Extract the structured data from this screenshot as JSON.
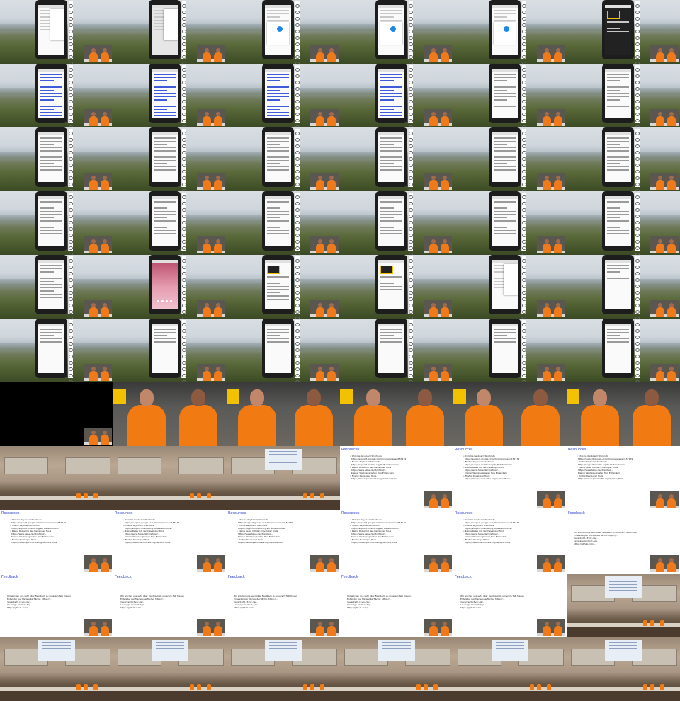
{
  "sheet": {
    "columns": 6,
    "rows": 11
  },
  "slides": {
    "resources_title": "Resources",
    "resources_items": [
      "• Chrome Keyboard Shortcuts",
      "  https://support.google.com/chrome/answer/157179",
      "• Firefox Keyboard Shortcuts",
      "  https://support.mozilla.org/kb/Tastaturkürzel",
      "• Kleine Reise mit den Developer Tools",
      "  https://www.heise.de/ct/artikel/...",
      "  Kleiner Werkzeugkasten fürs Entwickeln",
      "• Firefox Developer Tools",
      "  https://developer.mozilla.org/de/docs/Tools"
    ],
    "feedback_title": "Feedback",
    "feedback_lines": [
      "Wir würden uns sehr über Feedback zu unserem Talk freuen",
      "Entweder per Mensaoberfläche: https://...",
      "//events23.c3voc.de/...",
      "Leverage Android App",
      "https://github.com/..."
    ]
  },
  "cells": [
    {
      "kind": "phone",
      "screen": "menu",
      "pip": true
    },
    {
      "kind": "phone",
      "screen": "menu-gray",
      "pip": true
    },
    {
      "kind": "phone",
      "screen": "dialog",
      "pip": true
    },
    {
      "kind": "phone",
      "screen": "dialog",
      "pip": true
    },
    {
      "kind": "phone",
      "screen": "dialog",
      "pip": true
    },
    {
      "kind": "phone",
      "screen": "logo-dark",
      "pip": true
    },
    {
      "kind": "phone",
      "screen": "links",
      "pip": true
    },
    {
      "kind": "phone",
      "screen": "links",
      "pip": true
    },
    {
      "kind": "phone",
      "screen": "links",
      "pip": true
    },
    {
      "kind": "phone",
      "screen": "links",
      "pip": true
    },
    {
      "kind": "phone",
      "screen": "list",
      "pip": true
    },
    {
      "kind": "phone",
      "screen": "list",
      "pip": true
    },
    {
      "kind": "phone",
      "screen": "list",
      "pip": true
    },
    {
      "kind": "phone",
      "screen": "list",
      "pip": true
    },
    {
      "kind": "phone",
      "screen": "list",
      "pip": true
    },
    {
      "kind": "phone",
      "screen": "list",
      "pip": true
    },
    {
      "kind": "phone",
      "screen": "list",
      "pip": true
    },
    {
      "kind": "phone",
      "screen": "list",
      "pip": true
    },
    {
      "kind": "phone",
      "screen": "list",
      "pip": true
    },
    {
      "kind": "phone",
      "screen": "list",
      "pip": true
    },
    {
      "kind": "phone",
      "screen": "list",
      "pip": true
    },
    {
      "kind": "phone",
      "screen": "list",
      "pip": true
    },
    {
      "kind": "phone",
      "screen": "list",
      "pip": true
    },
    {
      "kind": "phone",
      "screen": "list",
      "pip": true
    },
    {
      "kind": "phone",
      "screen": "list",
      "pip": true
    },
    {
      "kind": "phone",
      "screen": "home",
      "pip": true
    },
    {
      "kind": "phone",
      "screen": "article",
      "pip": true
    },
    {
      "kind": "phone",
      "screen": "article-dark",
      "pip": true
    },
    {
      "kind": "phone",
      "screen": "menu",
      "pip": true
    },
    {
      "kind": "phone",
      "screen": "short",
      "pip": true
    },
    {
      "kind": "phone",
      "screen": "short",
      "pip": true
    },
    {
      "kind": "phone",
      "screen": "short",
      "pip": true
    },
    {
      "kind": "phone",
      "screen": "short",
      "pip": true
    },
    {
      "kind": "phone",
      "screen": "short",
      "pip": true
    },
    {
      "kind": "phone",
      "screen": "short",
      "pip": true
    },
    {
      "kind": "phone",
      "screen": "short",
      "pip": true
    },
    {
      "kind": "black",
      "pip": true
    },
    {
      "kind": "stage"
    },
    {
      "kind": "stage"
    },
    {
      "kind": "stage"
    },
    {
      "kind": "stage"
    },
    {
      "kind": "stage"
    },
    {
      "kind": "hall",
      "projection": false
    },
    {
      "kind": "hall",
      "projection": false
    },
    {
      "kind": "hall",
      "projection": true
    },
    {
      "kind": "slide",
      "slide": "resources",
      "pip": true
    },
    {
      "kind": "slide",
      "slide": "resources",
      "pip": true
    },
    {
      "kind": "slide",
      "slide": "resources",
      "pip": true
    },
    {
      "kind": "slide",
      "slide": "resources",
      "pip": true
    },
    {
      "kind": "slide",
      "slide": "resources",
      "pip": true
    },
    {
      "kind": "slide",
      "slide": "resources",
      "pip": true
    },
    {
      "kind": "slide",
      "slide": "resources",
      "pip": true
    },
    {
      "kind": "slide",
      "slide": "resources",
      "pip": true
    },
    {
      "kind": "slide",
      "slide": "feedback",
      "pip": true
    },
    {
      "kind": "slide",
      "slide": "feedback",
      "pip": true
    },
    {
      "kind": "slide",
      "slide": "feedback",
      "pip": true
    },
    {
      "kind": "slide",
      "slide": "feedback",
      "pip": true
    },
    {
      "kind": "slide",
      "slide": "feedback",
      "pip": true
    },
    {
      "kind": "slide",
      "slide": "feedback",
      "pip": true
    },
    {
      "kind": "hall",
      "projection": true
    },
    {
      "kind": "hall",
      "projection": true
    },
    {
      "kind": "hall",
      "projection": true
    },
    {
      "kind": "hall",
      "projection": true
    },
    {
      "kind": "hall",
      "projection": true
    },
    {
      "kind": "hall",
      "projection": true
    },
    {
      "kind": "hall",
      "projection": true
    }
  ]
}
